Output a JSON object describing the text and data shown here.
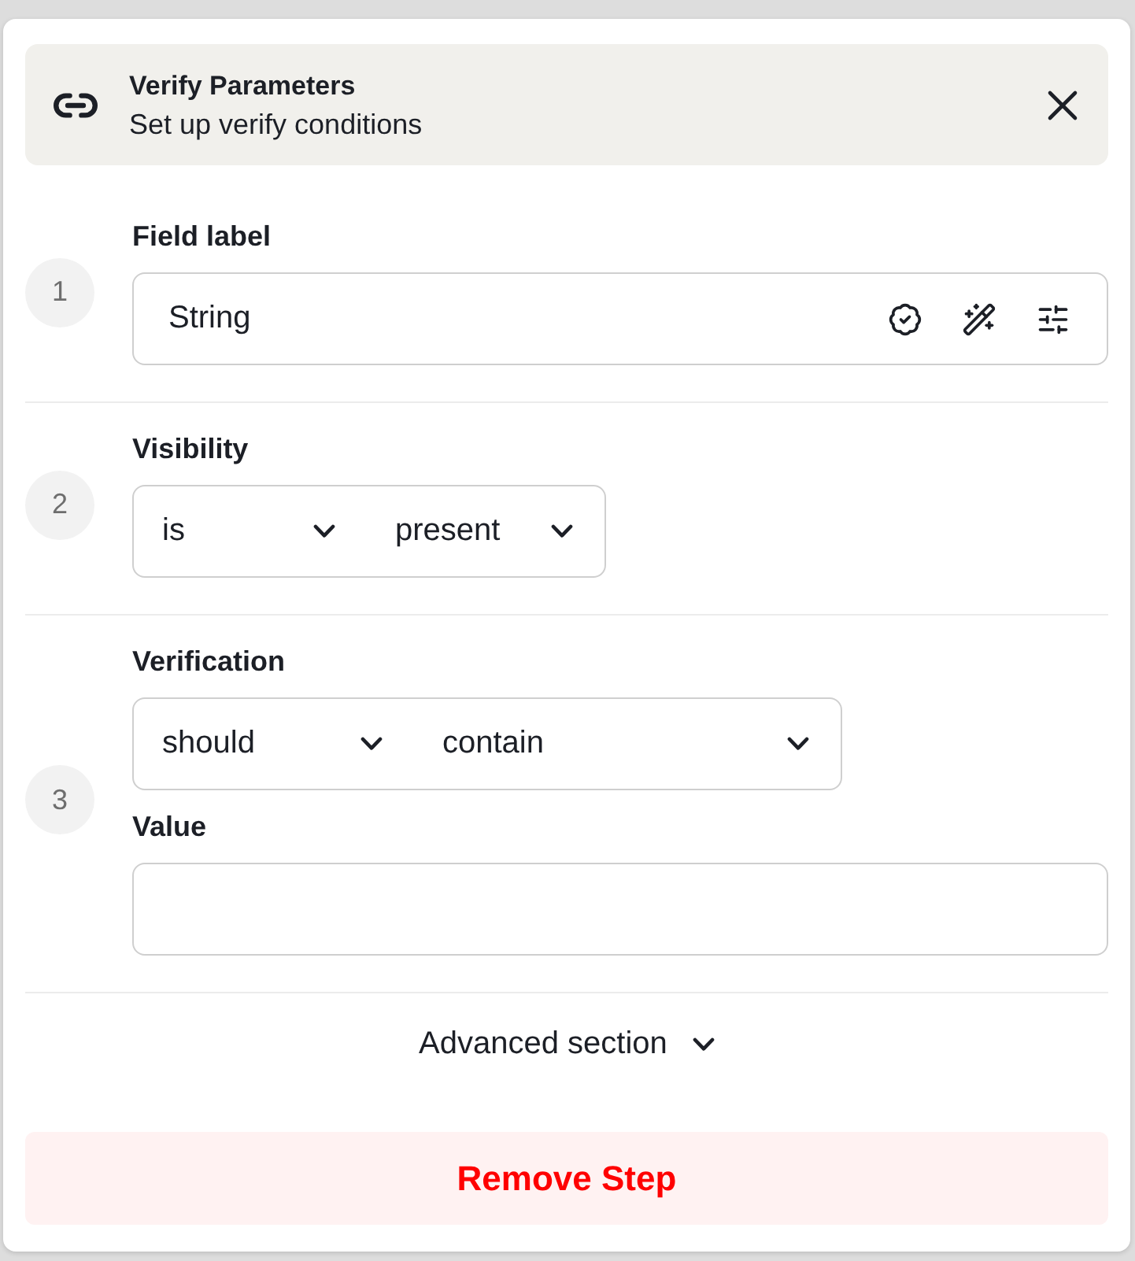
{
  "header": {
    "title": "Verify Parameters",
    "subtitle": "Set up verify conditions"
  },
  "steps": [
    {
      "number": "1",
      "fields": [
        {
          "kind": "tool_input",
          "label": "Field label",
          "value": "String"
        }
      ]
    },
    {
      "number": "2",
      "fields": [
        {
          "kind": "dropdowns",
          "label": "Visibility",
          "dropdowns": [
            {
              "value": "is"
            },
            {
              "value": "present"
            }
          ]
        }
      ]
    },
    {
      "number": "3",
      "fields": [
        {
          "kind": "dropdowns",
          "label": "Verification",
          "dropdowns": [
            {
              "value": "should"
            },
            {
              "value": "contain"
            }
          ]
        },
        {
          "kind": "input",
          "label": "Value"
        }
      ]
    }
  ],
  "advanced": {
    "label": "Advanced section",
    "expanded": false
  },
  "remove_button": {
    "label": "Remove Step"
  }
}
